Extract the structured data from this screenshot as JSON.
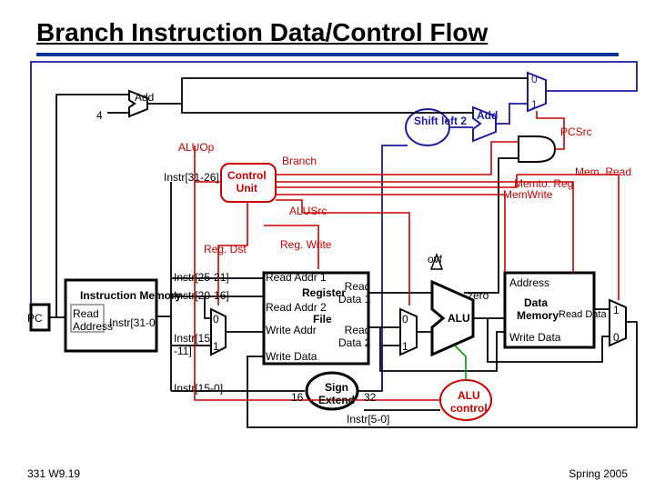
{
  "title": "Branch Instruction Data/Control Flow",
  "footer": {
    "left": "331 W9.19",
    "right": "Spring 2005"
  },
  "blocks": {
    "instr_mem": "Instruction\nMemory",
    "reg_file": "Register\nFile",
    "data_mem": "Data\nMemory",
    "control": "Control\nUnit",
    "alu_control": "ALU\ncontrol",
    "sign_ext": "Sign\nExtend",
    "shift_left": "Shift\nleft 2",
    "add1": "Add",
    "add2": "Add",
    "alu": "ALU"
  },
  "ports": {
    "pc": "PC",
    "read_addr": "Read\nAddress",
    "instr_out": "Instr[31-0]",
    "radd1": "Read Addr 1",
    "radd2": "Read Addr 2",
    "waddr": "Write Addr",
    "wdata": "Write Data",
    "rdata1": "Read\nData 1",
    "rdata2": "Read\nData 2",
    "dm_addr": "Address",
    "dm_wdata": "Write Data",
    "dm_rdata": "Read Data",
    "ext_in": "16",
    "ext_out": "32",
    "four": "4",
    "mux0": "0",
    "mux1": "1",
    "ovf": "ovf",
    "zero": "zero"
  },
  "signals": {
    "aluop": "ALUOp",
    "alusrc": "ALUSrc",
    "branch": "Branch",
    "regdst": "Reg. Dst",
    "regwrite": "Reg. Write",
    "memread": "Mem. Read",
    "memwrite": "MemWrite",
    "memtoreg": "Memto. Reg",
    "pcsrc": "PCSrc"
  },
  "bits": {
    "b31_26": "Instr[31-26]",
    "b25_21": "Instr[25-21]",
    "b20_16": "Instr[20-16]",
    "b15_11": "Instr[15\n-11]",
    "b15_0": "Instr[15-0]",
    "b5_0": "Instr[5-0]"
  }
}
